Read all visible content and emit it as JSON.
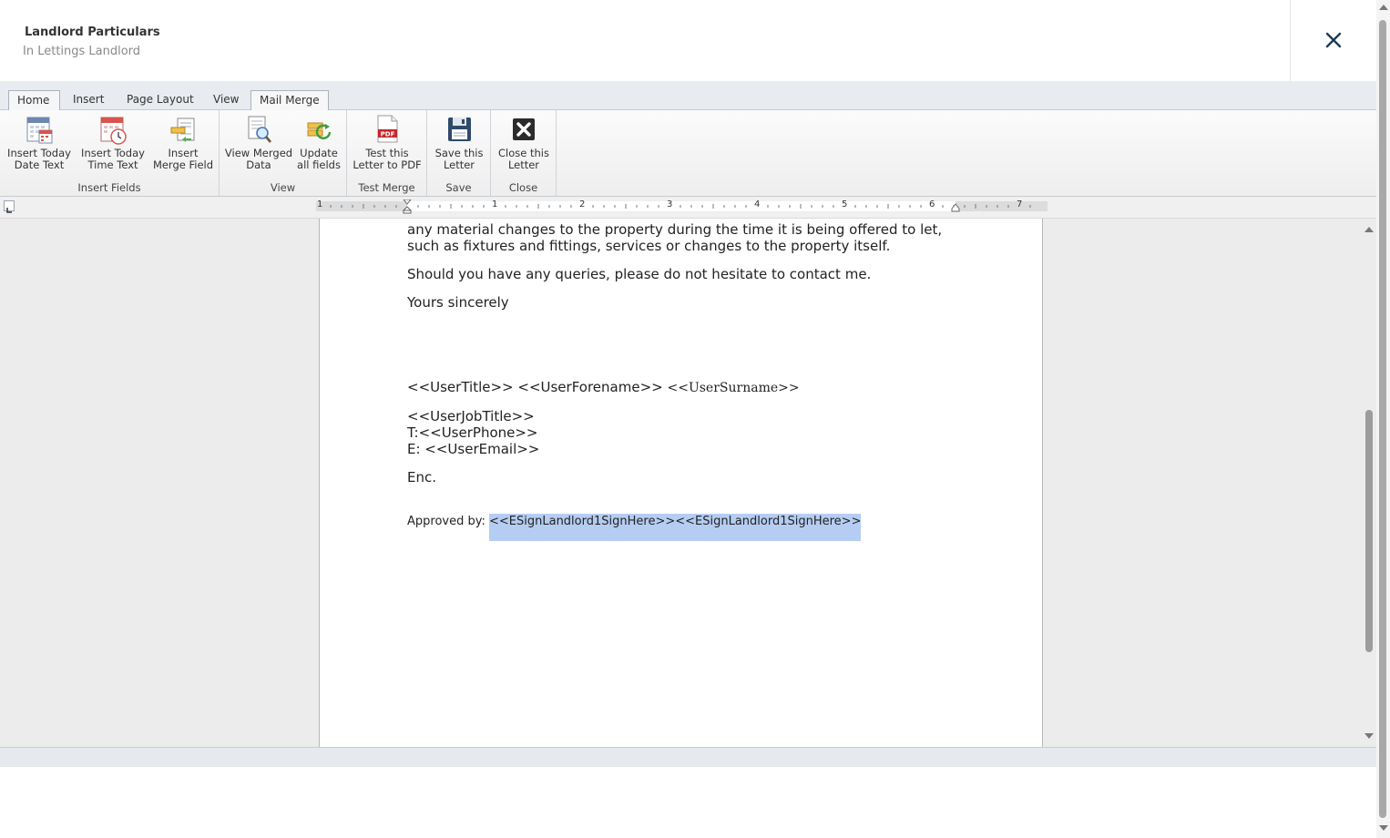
{
  "header": {
    "title": "Landlord Particulars",
    "subtitle": "In Lettings Landlord"
  },
  "tabs": [
    "Home",
    "Insert",
    "Page Layout",
    "View",
    "Mail Merge"
  ],
  "active_tab": "Mail Merge",
  "ribbon": {
    "groups": [
      {
        "label": "Insert Fields",
        "buttons": [
          {
            "line1": "Insert Today",
            "line2": "Date Text",
            "icon": "calendar-date-icon"
          },
          {
            "line1": "Insert Today",
            "line2": "Time Text",
            "icon": "calendar-clock-icon"
          },
          {
            "line1": "Insert",
            "line2": "Merge Field",
            "icon": "merge-field-icon"
          }
        ]
      },
      {
        "label": "View",
        "buttons": [
          {
            "line1": "View Merged",
            "line2": "Data",
            "icon": "magnifier-document-icon"
          },
          {
            "line1": "Update",
            "line2": "all fields",
            "icon": "refresh-fields-icon"
          }
        ]
      },
      {
        "label": "Test Merge",
        "buttons": [
          {
            "line1": "Test this",
            "line2": "Letter to PDF",
            "icon": "pdf-icon"
          }
        ]
      },
      {
        "label": "Save",
        "buttons": [
          {
            "line1": "Save this",
            "line2": "Letter",
            "icon": "floppy-disk-icon"
          }
        ]
      },
      {
        "label": "Close",
        "buttons": [
          {
            "line1": "Close this",
            "line2": "Letter",
            "icon": "close-box-icon"
          }
        ]
      }
    ]
  },
  "ruler": {
    "numbers": [
      "1",
      "1",
      "2",
      "3",
      "4",
      "5",
      "6",
      "7"
    ]
  },
  "document": {
    "line1": "any material changes to the property during the time it is being offered to let,",
    "line2": "such as fixtures and fittings, services or changes to the property itself.",
    "queries": "Should you have any queries, please do not hesitate to contact me.",
    "closing": "Yours sincerely",
    "user_name_a": "<<UserTitle>> <<UserForename>> ",
    "user_name_b": "<<UserSurname>>",
    "job_title": "<<UserJobTitle>>",
    "phone": "T:<<UserPhone>>",
    "email": "E: <<UserEmail>>",
    "enc": "Enc.",
    "approved_label": "Approved by: ",
    "approved_field": "<<ESignLandlord1SignHere>><<ESignLandlord1SignHere>>"
  },
  "colors": {
    "selection": "#b5cdf2",
    "pdf_red": "#c0282a"
  }
}
